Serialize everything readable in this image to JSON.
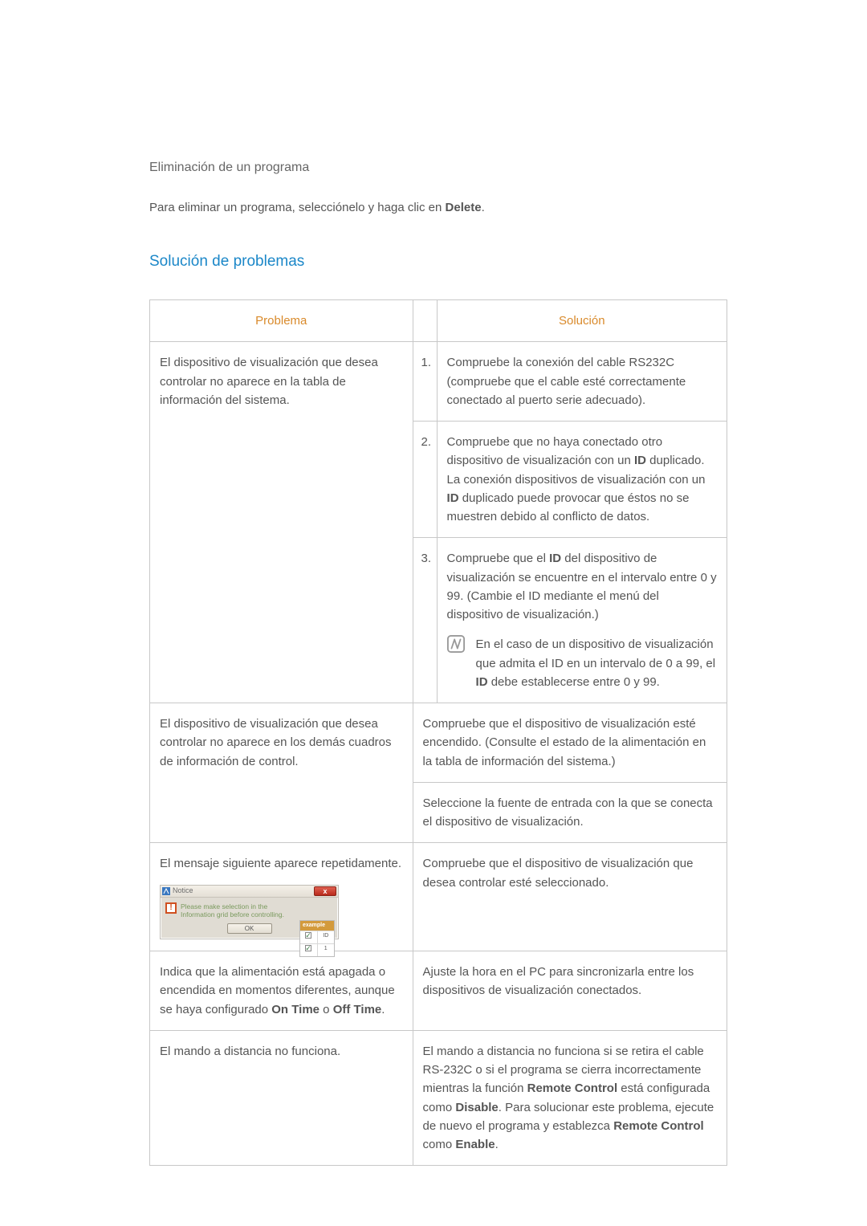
{
  "section1": {
    "heading": "Eliminación de un programa",
    "intro_prefix": "Para eliminar un programa, selecciónelo y haga clic en ",
    "intro_bold": "Delete",
    "intro_suffix": "."
  },
  "section2": {
    "heading": "Solución de problemas"
  },
  "table": {
    "headers": {
      "problem": "Problema",
      "solution": "Solución"
    },
    "row1": {
      "problem": "El dispositivo de visualización que desea controlar no aparece en la tabla de información del sistema.",
      "sol1_num": "1.",
      "sol1": "Compruebe la conexión del cable RS232C (compruebe que el cable esté correctamente conectado al puerto serie adecuado).",
      "sol2_num": "2.",
      "sol2_a": "Compruebe que no haya conectado otro dispositivo de visualización con un ",
      "sol2_b": "ID",
      "sol2_c": " duplicado. La conexión dispositivos de visualización con un ",
      "sol2_d": "ID",
      "sol2_e": " duplicado puede provocar que éstos no se muestren debido al conflicto de datos.",
      "sol3_num": "3.",
      "sol3_a": "Compruebe que el ",
      "sol3_b": "ID",
      "sol3_c": " del dispositivo de visualización se encuentre en el intervalo entre 0 y 99. (Cambie el ID mediante el menú del dispositivo de visualización.)",
      "sol3_note_a": "En el caso de un dispositivo de visualización que admita el ID en un intervalo de 0 a 99, el ",
      "sol3_note_b": "ID",
      "sol3_note_c": " debe establecerse entre 0 y 99."
    },
    "row2": {
      "problem": "El dispositivo de visualización que desea controlar no aparece en los demás cuadros de información de control.",
      "sol1": "Compruebe que el dispositivo de visualización esté encendido. (Consulte el estado de la alimentación en la tabla de información del sistema.)",
      "sol2": "Seleccione la fuente de entrada con la que se conecta el dispositivo de visualización."
    },
    "row3": {
      "problem": "El mensaje siguiente aparece repetidamente.",
      "sol": "Compruebe que el dispositivo de visualización que desea controlar esté seleccionado."
    },
    "row4": {
      "problem_a": "Indica que la alimentación está apagada o encendida en momentos diferentes, aunque se haya configurado ",
      "problem_b": "On Time",
      "problem_c": " o ",
      "problem_d": "Off Time",
      "problem_e": ".",
      "sol": "Ajuste la hora en el PC para sincronizarla entre los dispositivos de visualización conectados."
    },
    "row5": {
      "problem": "El mando a distancia no funciona.",
      "sol_a": "El mando a distancia no funciona si se retira el cable RS-232C o si el programa se cierra incorrectamente mientras la función ",
      "sol_b": "Remote Control",
      "sol_c": " está configurada como ",
      "sol_d": "Disable",
      "sol_e": ". Para solucionar este problema, ejecute de nuevo el programa y establezca ",
      "sol_f": "Remote Control",
      "sol_g": " como ",
      "sol_h": "Enable",
      "sol_i": "."
    }
  },
  "dialog": {
    "title": "Notice",
    "close": "x",
    "msg_line1": "Please make selection in the",
    "msg_line2": "Information grid before controlling.",
    "ok": "OK",
    "example_head": "example",
    "example_id": "ID",
    "example_val": "1"
  }
}
